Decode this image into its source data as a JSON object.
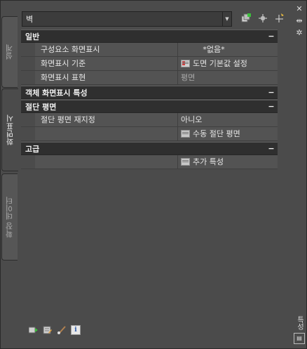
{
  "tabs": {
    "design": "설계",
    "display": "화면표시",
    "extended": "확장 데이터"
  },
  "side_strip": {
    "title": "특성",
    "icons": [
      "close-icon",
      "autohide-icon",
      "settings-icon"
    ]
  },
  "selector": {
    "value": "벽"
  },
  "toolbar": {
    "icons": [
      "add-object-icon",
      "quick-select-icon",
      "select-objects-icon"
    ]
  },
  "grid": {
    "general": {
      "title": "일반",
      "collapse": "−",
      "rows": [
        {
          "name": "구성요소 화면표시",
          "value": "*없음*"
        },
        {
          "name": "화면표시 기준",
          "value": "도면 기본값 설정"
        },
        {
          "name": "화면표시 표현",
          "value": "평면"
        }
      ]
    },
    "object_display": {
      "title": "객체 화면표시 특성",
      "collapse": "−"
    },
    "cut_plane": {
      "title": "절단 평면",
      "collapse": "−",
      "rows": [
        {
          "name": "절단 평면 재지정",
          "value": "아니오"
        },
        {
          "name": "",
          "value": "수동 절단 평면"
        }
      ]
    },
    "advanced": {
      "title": "고급",
      "collapse": "−",
      "rows": [
        {
          "name": "",
          "value": "추가 특성"
        }
      ]
    }
  },
  "bottom_tools": [
    "select-icon",
    "edit-style-icon",
    "brush-icon",
    "info-icon"
  ],
  "colors": {
    "panel": "#4b4b4b",
    "category": "#2f2f2f",
    "row": "#535353",
    "text": "#e6e6e6"
  }
}
